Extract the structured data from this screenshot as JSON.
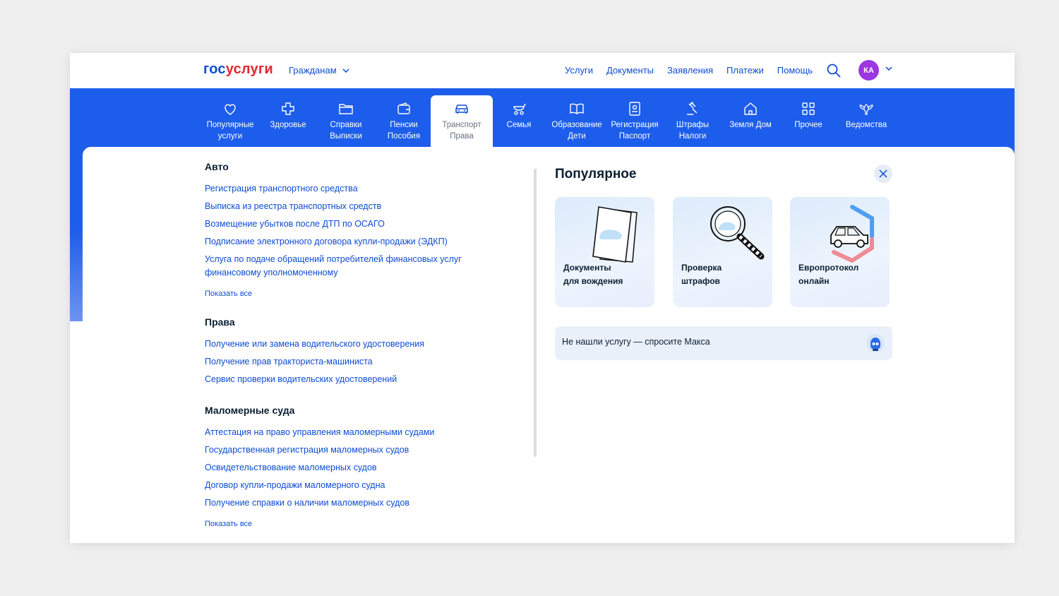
{
  "header": {
    "logo_part1": "гос",
    "logo_part2": "услуги",
    "audience": "Гражданам",
    "nav": [
      "Услуги",
      "Документы",
      "Заявления",
      "Платежи",
      "Помощь"
    ],
    "user_initials": "КА"
  },
  "categories": [
    {
      "line1": "Популярные",
      "line2": "услуги",
      "icon": "heart-icon"
    },
    {
      "line1": "Здоровье",
      "line2": "",
      "icon": "cross-icon"
    },
    {
      "line1": "Справки",
      "line2": "Выписки",
      "icon": "folder-icon"
    },
    {
      "line1": "Пенсии",
      "line2": "Пособия",
      "icon": "wallet-icon"
    },
    {
      "line1": "Транспорт",
      "line2": "Права",
      "icon": "car-icon",
      "active": true
    },
    {
      "line1": "Семья",
      "line2": "",
      "icon": "stroller-icon"
    },
    {
      "line1": "Образование",
      "line2": "Дети",
      "icon": "book-icon"
    },
    {
      "line1": "Регистрация",
      "line2": "Паспорт",
      "icon": "passport-icon"
    },
    {
      "line1": "Штрафы",
      "line2": "Налоги",
      "icon": "gavel-icon"
    },
    {
      "line1": "Земля Дом",
      "line2": "",
      "icon": "house-icon"
    },
    {
      "line1": "Прочее",
      "line2": "",
      "icon": "grid-icon"
    },
    {
      "line1": "Ведомства",
      "line2": "",
      "icon": "eagle-icon"
    }
  ],
  "sections": [
    {
      "title": "Авто",
      "links": [
        "Регистрация транспортного средства",
        "Выписка из реестра транспортных средств",
        "Возмещение убытков после ДТП по ОСАГО",
        "Подписание электронного договора купли-продажи (ЭДКП)",
        "Услуга по подаче обращений потребителей финансовых услуг финансовому уполномоченному"
      ],
      "show_all": "Показать все"
    },
    {
      "title": "Права",
      "links": [
        "Получение или замена водительского удостоверения",
        "Получение прав тракториста-машиниста",
        "Сервис проверки водительских удостоверений"
      ],
      "show_all": ""
    },
    {
      "title": "Маломерные суда",
      "links": [
        "Аттестация на право управления маломерными судами",
        "Государственная регистрация маломерных судов",
        "Освидетельствование маломерных судов",
        "Договор купли-продажи маломерного судна",
        "Получение справки о наличии маломерных судов"
      ],
      "show_all": "Показать все"
    }
  ],
  "popular": {
    "title": "Популярное",
    "cards": [
      {
        "line1": "Документы",
        "line2": "для вождения",
        "icon": "documents-icon"
      },
      {
        "line1": "Проверка",
        "line2": "штрафов",
        "icon": "magnifier-icon"
      },
      {
        "line1": "Европротокол",
        "line2": "онлайн",
        "icon": "car-shield-icon"
      }
    ],
    "ask": "Не нашли услугу — спросите Макса"
  },
  "colors": {
    "brand_blue": "#0d4cd3",
    "band_blue": "#1d5deb",
    "logo_red": "#e3262f",
    "avatar": "#9b36e0"
  }
}
